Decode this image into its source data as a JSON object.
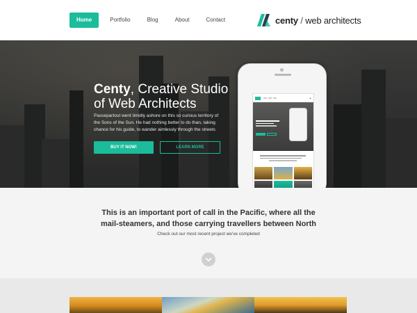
{
  "nav": {
    "items": [
      {
        "label": "Home",
        "active": true
      },
      {
        "label": "Portfolio"
      },
      {
        "label": "Blog"
      },
      {
        "label": "About"
      },
      {
        "label": "Contact"
      }
    ],
    "brand": {
      "name": "centy",
      "separator": "/",
      "tagline": "web architects",
      "logo_icon": "centy-logo-icon"
    }
  },
  "hero": {
    "title_bold": "Centy",
    "title_rest": ", Creative Studio of Web Architects",
    "description": "Passepartout went timidly ashore on this so curious territory of the Sons of the Sun. He had nothing better to do than, taking chance for his guide, to wander aimlessly through the streets",
    "buy_label": "BUY IT NOW!",
    "learn_label": "LEARN MORE"
  },
  "intro": {
    "heading": "This is an important port of call in the Pacific, where all the mail-steamers, and those carrying travellers between North",
    "subheading": "Check out our most recent project we've completed",
    "scroll_icon": "chevron-down-icon"
  },
  "colors": {
    "accent": "#1bbc9b",
    "intro_bg": "#f4f4f4",
    "gallery_bg": "#e9e9e9"
  }
}
